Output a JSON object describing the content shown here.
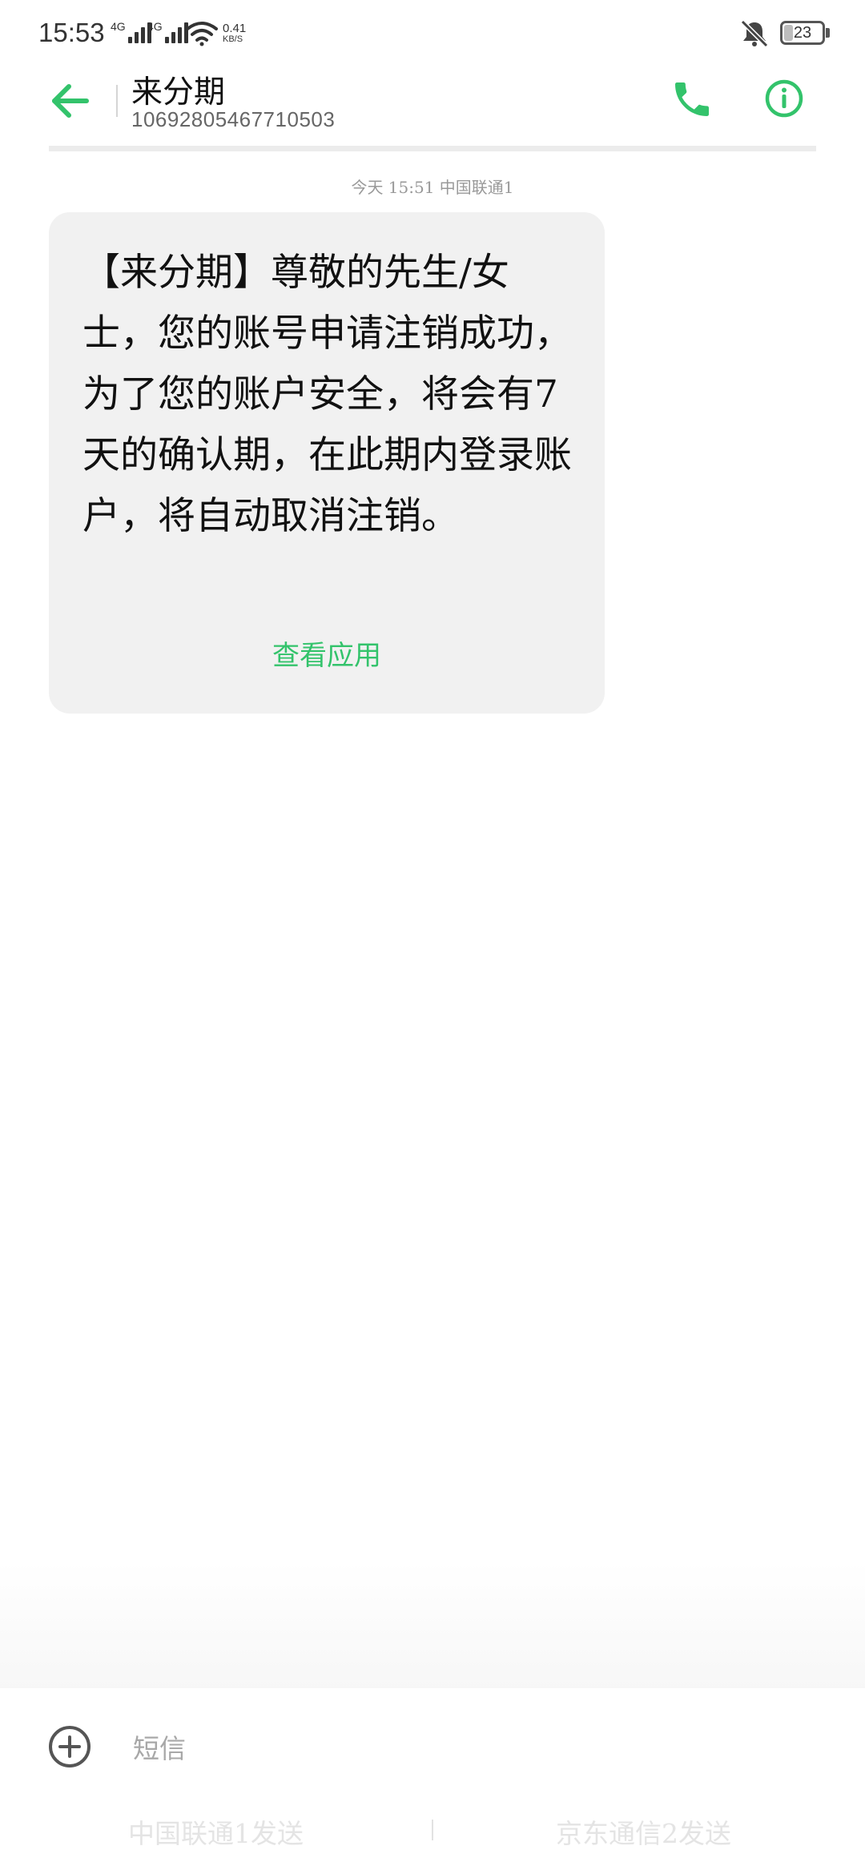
{
  "status_bar": {
    "time": "15:53",
    "network1": "4G",
    "network2": "4G",
    "speed_value": "0.41",
    "speed_unit": "KB/S",
    "battery": "23",
    "battery_level": 0.23
  },
  "header": {
    "contact_name": "来分期",
    "contact_number": "10692805467710503"
  },
  "conversation": {
    "meta": "今天 15:51  中国联通1",
    "message": {
      "text": "【来分期】尊敬的先生/女士，您的账号申请注销成功，为了您的账户安全，将会有7天的确认期，在此期内登录账户，将自动取消注销。",
      "action": "查看应用"
    }
  },
  "composer": {
    "placeholder": "短信",
    "send_sim1": "中国联通1发送",
    "send_sim2": "京东通信2发送"
  },
  "colors": {
    "accent": "#33c36b",
    "bubble_bg": "#f1f1f1"
  },
  "icons": [
    "back-arrow-icon",
    "phone-icon",
    "info-icon",
    "add-circle-icon",
    "mute-icon",
    "wifi-icon",
    "battery-icon"
  ]
}
